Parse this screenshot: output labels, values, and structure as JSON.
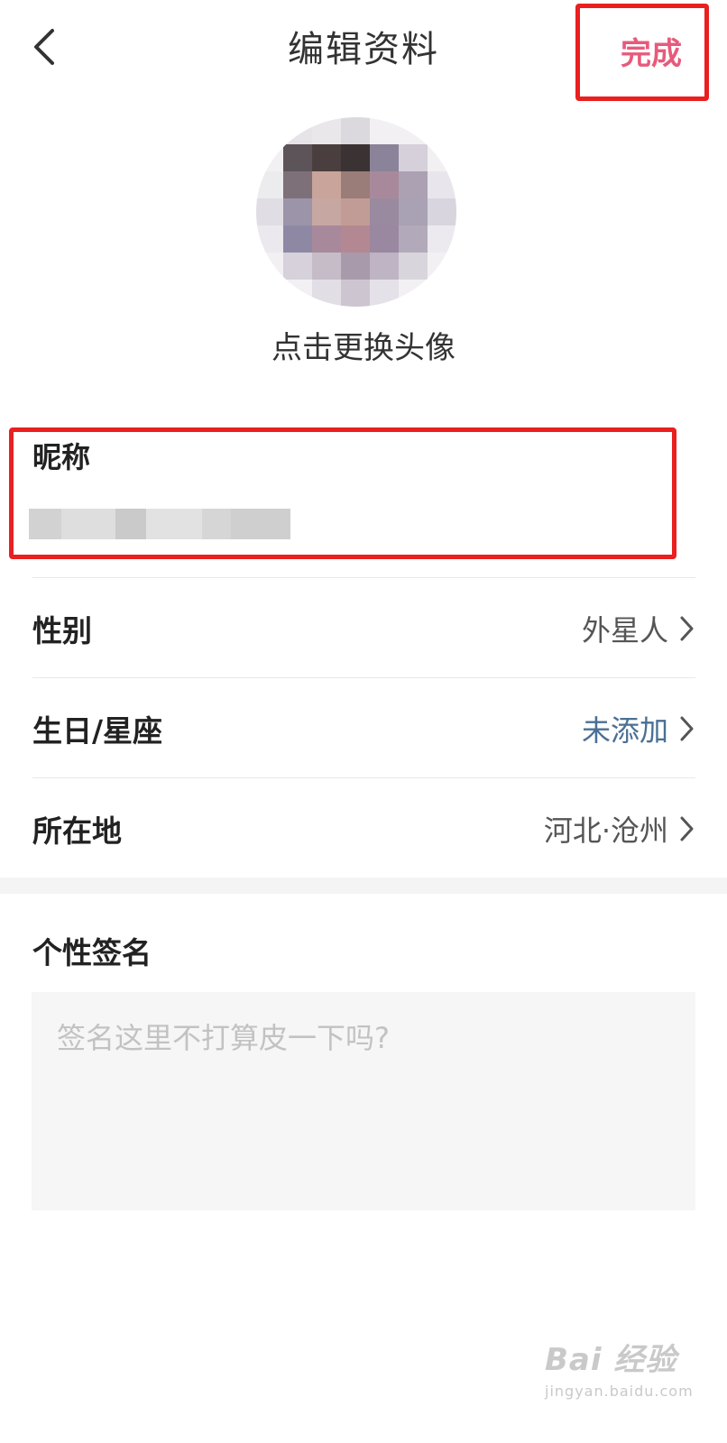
{
  "header": {
    "title": "编辑资料",
    "done_label": "完成"
  },
  "avatar": {
    "change_label": "点击更换头像"
  },
  "nickname": {
    "label": "昵称"
  },
  "rows": [
    {
      "label": "性别",
      "value": "外星人"
    },
    {
      "label": "生日/星座",
      "value": "未添加"
    },
    {
      "label": "所在地",
      "value": "河北·沧州"
    }
  ],
  "signature": {
    "label": "个性签名",
    "placeholder": "签名这里不打算皮一下吗?",
    "value": ""
  },
  "watermark": {
    "main": "Bai 经验",
    "sub": "jingyan.baidu.com"
  },
  "colors": {
    "accent": "#e75a7c",
    "highlight_box": "#ea1f1f",
    "link_value": "#4a6f94"
  }
}
